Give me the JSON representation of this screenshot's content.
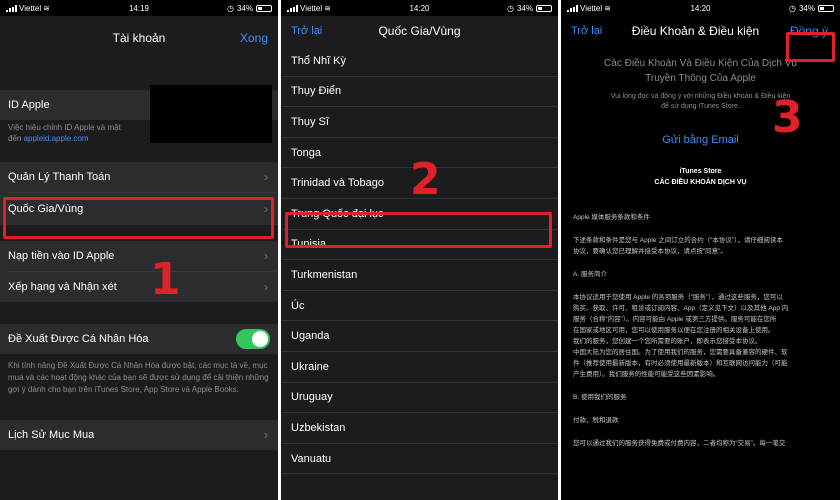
{
  "status_bars": [
    {
      "carrier": "Viettel",
      "time": "14:19",
      "battery": "34%"
    },
    {
      "carrier": "Viettel",
      "time": "14:20",
      "battery": "34%"
    },
    {
      "carrier": "Viettel",
      "time": "14:20",
      "battery": "34%"
    }
  ],
  "panel1": {
    "title": "Tài khoản",
    "done": "Xong",
    "apple_id": "ID Apple",
    "apple_id_note_1": "Việc hiệu chỉnh ID Apple và mật",
    "apple_id_note_2": "đến ",
    "apple_id_link": "appleid.apple.com",
    "payment": "Quản Lý Thanh Toán",
    "country": "Quốc Gia/Vùng",
    "topup": "Nạp tiền vào ID Apple",
    "ratings": "Xếp hạng và Nhận xét",
    "personal": "Đề Xuất Được Cá Nhân Hóa",
    "personal_note": "Khi tính năng Đề Xuất Được Cá Nhân Hóa được bật, các mục tả về, mục mua và các hoạt động khác của bạn sẽ được sử dụng để cải thiện những gợi ý dành cho bạn trên iTunes Store, App Store và Apple Books.",
    "history": "Lịch Sử Mục Mua",
    "step": "1"
  },
  "panel2": {
    "back": "Trở lại",
    "title": "Quốc Gia/Vùng",
    "countries": [
      "Thổ Nhĩ Kỳ",
      "Thụy Điển",
      "Thụy Sĩ",
      "Tonga",
      "Trinidad và Tobago",
      "Trung Quốc đại lục",
      "Tunisia",
      "Turkmenistan",
      "Úc",
      "Uganda",
      "Ukraine",
      "Uruguay",
      "Uzbekistan",
      "Vanuatu"
    ],
    "step": "2"
  },
  "panel3": {
    "back": "Trở lại",
    "title": "Điều Khoản & Điều kiện",
    "agree": "Đồng ý",
    "heading_1": "Các Điều Khoản Và Điều Kiện Của Dịch Vụ",
    "heading_2": "Truyền Thông Của Apple",
    "sub_1": "Vui lòng đọc và đồng ý với những Điều khoản & Điều kiện",
    "sub_2": "để sử dụng iTunes Store.",
    "email": "Gửi bằng Email",
    "store_1": "iTunes Store",
    "store_2": "CÁC ĐIỀU KHOẢN DỊCH VỤ",
    "p1": "Apple 媒体服务条款和条件",
    "p2a": "下述条款和条件是您与 Apple 之间订立的合约（“本协议”），请仔细阅读本",
    "p2b": "协议，要确认您已理解并接受本协议，请点按“同意”。",
    "p3": "A. 服务简介",
    "p4a": "本协议适用于您使用 Apple 的各项服务（“服务”），通过这些服务，您可以",
    "p4b": "购买、获取、许可、租赁或订阅内容、App（定义见下文）以及其他 App 内",
    "p4c": "服务（合称“内容”）。内容可能由 Apple 或第三方提供。服务可能在您所",
    "p4d": "在国家或地区可用，您可以使用服务以便在您注册的相关设备上使用。",
    "p4e": "我们的服务，您创建一个您所需要的账户，即表示您接受本协议。",
    "p4f": "中国大陆为您的居住国。为了使用我们的服务，您需要具备兼容的硬件、软",
    "p4g": "件（推荐使用最新版本，有时必须使用最新版本）和互联网访问能力（可能",
    "p4h": "产生费用）。我们服务的性能可能受这些因素影响。",
    "p5": "B. 使用我们的服务",
    "p6": "付款、税和退款",
    "p7": "您可以通过我们的服务获得免费或付费内容，二者均称为“交易”。每一笔交",
    "step": "3"
  }
}
